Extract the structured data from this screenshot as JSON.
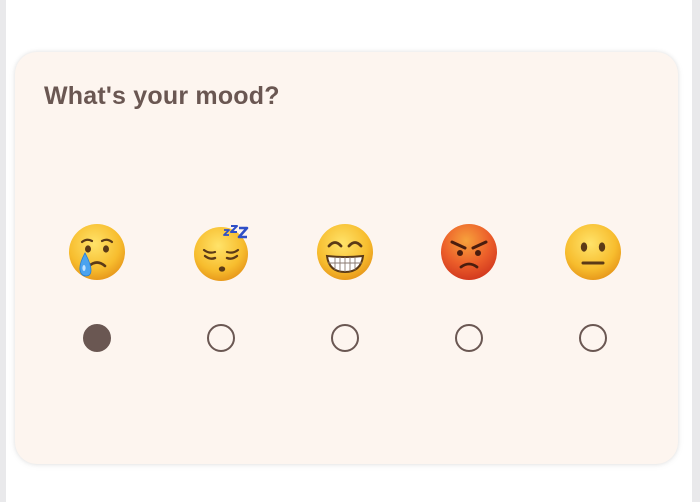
{
  "mood_card": {
    "question": "What's your mood?",
    "selected_index": 0,
    "options": [
      {
        "icon": "crying-face-icon",
        "label": "sad",
        "selected": true
      },
      {
        "icon": "sleeping-face-icon",
        "label": "sleepy",
        "selected": false
      },
      {
        "icon": "grinning-face-icon",
        "label": "happy",
        "selected": false
      },
      {
        "icon": "angry-face-icon",
        "label": "angry",
        "selected": false
      },
      {
        "icon": "neutral-face-icon",
        "label": "neutral",
        "selected": false
      }
    ]
  },
  "colors": {
    "card_background": "#fdf5ef",
    "text_and_radio": "#6a5752",
    "page_background": "#ffffff"
  }
}
